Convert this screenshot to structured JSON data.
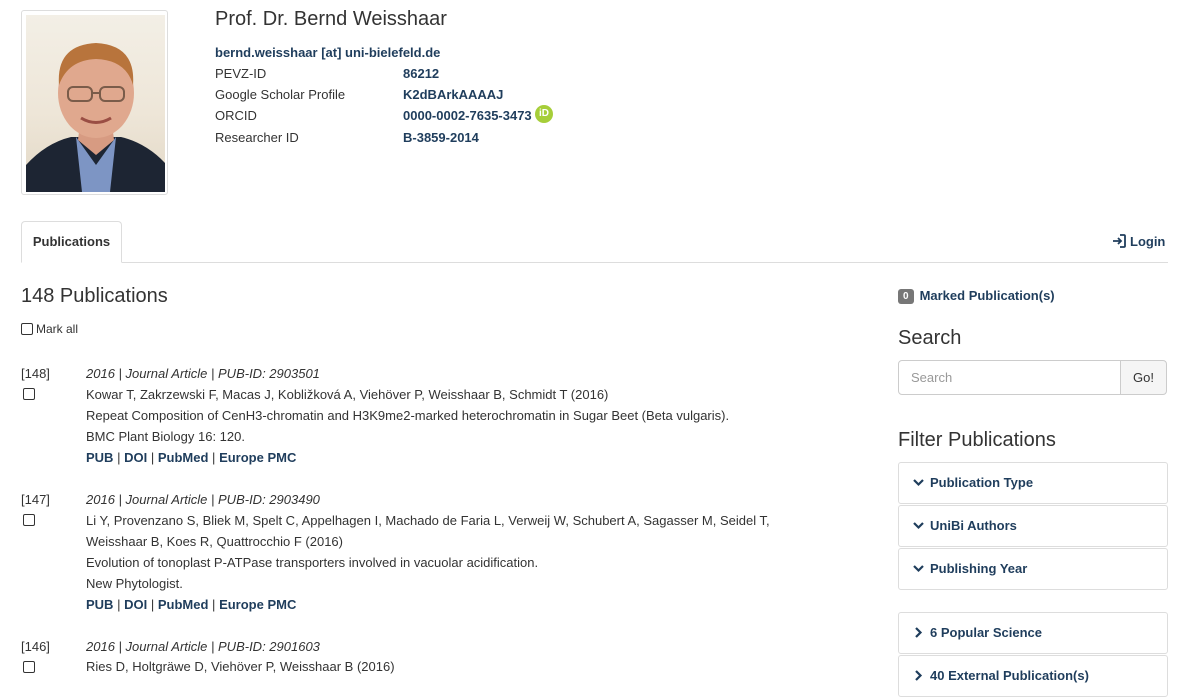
{
  "profile": {
    "name": "Prof. Dr. Bernd Weisshaar",
    "email": "bernd.weisshaar [at] uni-bielefeld.de",
    "fields": [
      {
        "label": "PEVZ-ID",
        "value": "86212"
      },
      {
        "label": "Google Scholar Profile",
        "value": "K2dBArkAAAAJ"
      },
      {
        "label": "ORCID",
        "value": "0000-0002-7635-3473"
      },
      {
        "label": "Researcher ID",
        "value": "B-3859-2014"
      }
    ],
    "orcid_badge": "iD"
  },
  "tabs": {
    "active": "Publications",
    "login": "Login"
  },
  "publications": {
    "count_title": "148 Publications",
    "mark_all": "Mark all",
    "link_separator": "|",
    "items": [
      {
        "num": "[148]",
        "meta": "2016 | Journal Article | PUB-ID: 2903501",
        "lines": [
          "Kowar T, Zakrzewski F, Macas J, Kobližková A, Viehöver P, Weisshaar B, Schmidt T (2016)",
          "Repeat Composition of CenH3-chromatin and H3K9me2-marked heterochromatin in Sugar Beet (Beta vulgaris).",
          "BMC Plant Biology 16: 120."
        ],
        "links": [
          "PUB",
          "DOI",
          "PubMed",
          "Europe PMC"
        ]
      },
      {
        "num": "[147]",
        "meta": "2016 | Journal Article | PUB-ID: 2903490",
        "lines": [
          "Li Y, Provenzano S, Bliek M, Spelt C, Appelhagen I, Machado de Faria L, Verweij W, Schubert A, Sagasser M, Seidel T,",
          "Weisshaar B, Koes R, Quattrocchio F (2016)",
          "Evolution of tonoplast P-ATPase transporters involved in vacuolar acidification.",
          "New Phytologist."
        ],
        "links": [
          "PUB",
          "DOI",
          "PubMed",
          "Europe PMC"
        ]
      },
      {
        "num": "[146]",
        "meta": "2016 | Journal Article | PUB-ID: 2901603",
        "lines": [
          "Ries D, Holtgräwe D, Viehöver P, Weisshaar B (2016)"
        ],
        "links": []
      }
    ]
  },
  "sidebar": {
    "marked_count": "0",
    "marked_label": "Marked Publication(s)",
    "search_heading": "Search",
    "search_placeholder": "Search",
    "search_button": "Go!",
    "filter_heading": "Filter Publications",
    "filters": [
      "Publication Type",
      "UniBi Authors",
      "Publishing Year"
    ],
    "categories": [
      "6 Popular Science",
      "40 External Publication(s)"
    ]
  },
  "colors": {
    "link": "#1f3d5c",
    "orcid": "#a6ce39",
    "badge": "#777777"
  }
}
